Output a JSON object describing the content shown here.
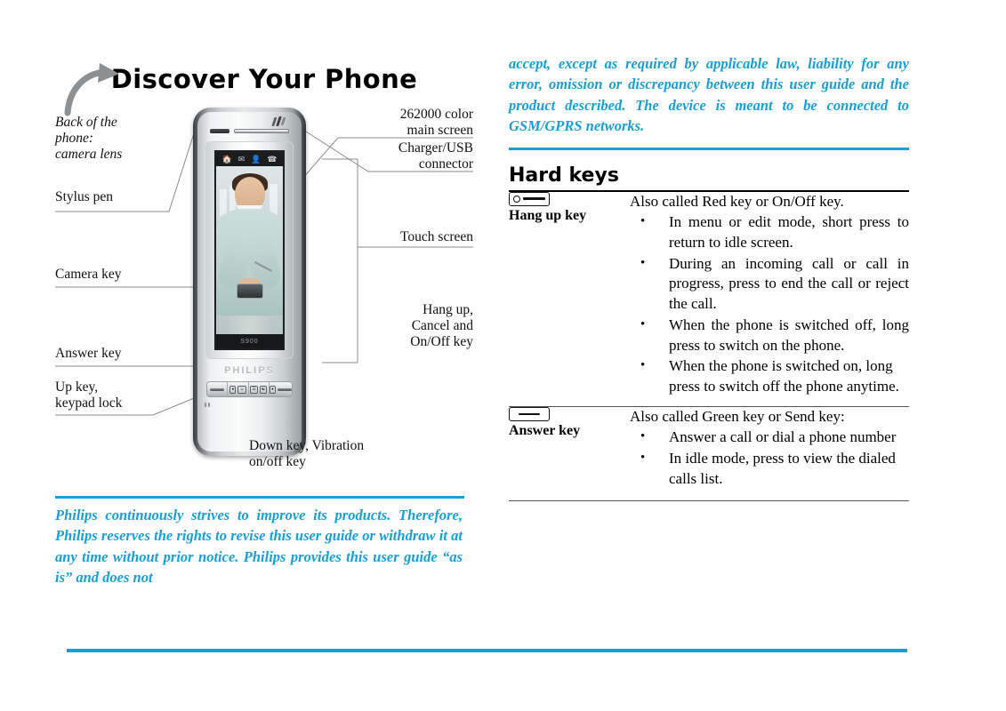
{
  "document": {
    "title": "Discover Your Phone"
  },
  "figure": {
    "phone_brand": "PHILIPS",
    "phone_model_on_screen": "S900",
    "status_icons": [
      "home-icon",
      "envelope-icon",
      "contact-icon",
      "call-icon"
    ],
    "labels_left": [
      {
        "id": "back-of-phone",
        "text": "Back of the\nphone:\ncamera lens",
        "style": "italic"
      },
      {
        "id": "stylus-pen",
        "text": "Stylus pen",
        "style": "normal"
      },
      {
        "id": "camera-key",
        "text": "Camera key",
        "style": "normal"
      },
      {
        "id": "answer-key",
        "text": "Answer key",
        "style": "normal"
      },
      {
        "id": "up-key",
        "text": "Up key,\nkeypad lock",
        "style": "normal"
      }
    ],
    "labels_right": [
      {
        "id": "main-screen",
        "text": "262000 color\nmain screen"
      },
      {
        "id": "charger-usb",
        "text": "Charger/USB\nconnector"
      },
      {
        "id": "touch-screen",
        "text": "Touch screen"
      },
      {
        "id": "hang-up",
        "text": "Hang up,\nCancel and\nOn/Off key"
      }
    ],
    "labels_bottom": [
      {
        "id": "down-key",
        "text": "Down key, Vibration\non/off key"
      }
    ]
  },
  "left_notice": {
    "text": "Philips continuously strives to improve its products. Therefore, Philips reserves the rights to revise this user guide or withdraw it at any time without prior notice. Philips provides this user guide “as is” and does not"
  },
  "right_notice": {
    "text": "accept, except as required by applicable law, liability for any error, omission or discrepancy between this user guide and the product described. The device is meant to be connected to GSM/GPRS networks."
  },
  "hard_keys": {
    "heading": "Hard keys",
    "rows": [
      {
        "key_name": "Hang up key",
        "icon": "hang-up-key-icon",
        "lead": "Also called Red key or On/Off key.",
        "bullets": [
          "In menu or edit mode, short press to return to idle screen.",
          "During an incoming call or call in progress, press to end the call or reject the call.",
          "When the phone is switched off, long press to switch on the phone.",
          "When the phone is switched on, long press to switch off the phone anytime."
        ]
      },
      {
        "key_name": "Answer key",
        "icon": "answer-key-icon",
        "lead": "Also called Green key or Send key:",
        "bullets": [
          "Answer a call or dial a phone number",
          "In idle mode, press to view the dialed calls list."
        ]
      }
    ]
  },
  "colors": {
    "accent_blue": "#1a9fd4",
    "rule_black": "#000000"
  }
}
